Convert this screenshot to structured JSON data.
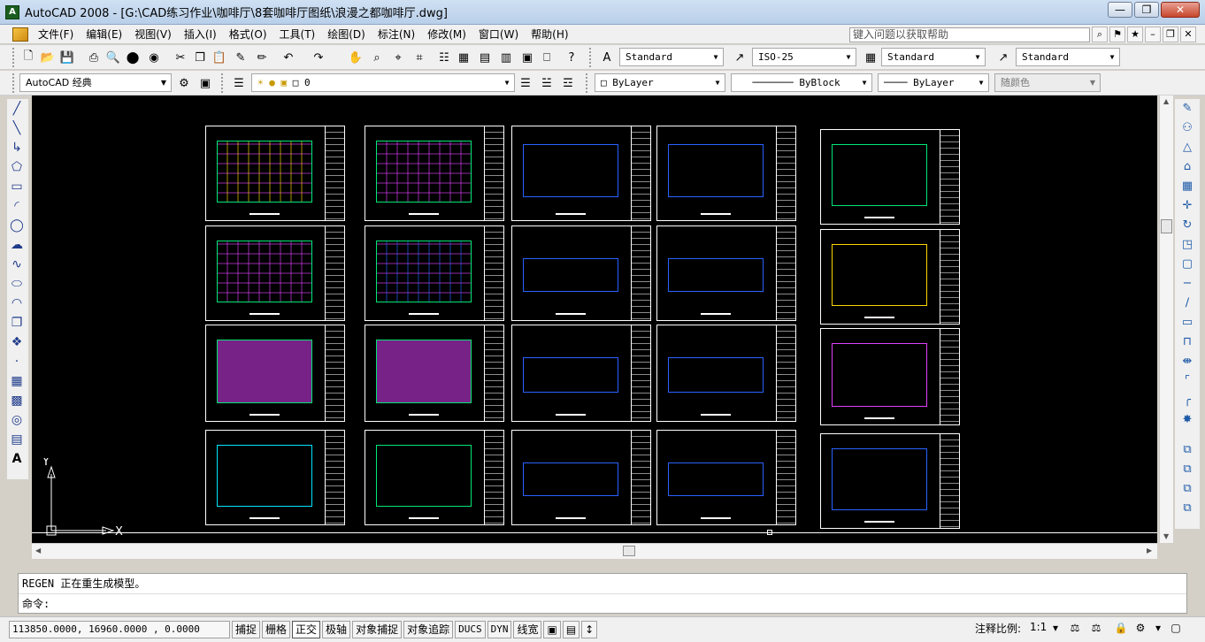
{
  "window": {
    "title": "AutoCAD 2008 - [G:\\CAD练习作业\\咖啡厅\\8套咖啡厅图纸\\浪漫之都咖啡厅.dwg]",
    "minimize": "—",
    "restore": "❐",
    "close": "✕"
  },
  "menu": {
    "items": [
      "文件(F)",
      "编辑(E)",
      "视图(V)",
      "插入(I)",
      "格式(O)",
      "工具(T)",
      "绘图(D)",
      "标注(N)",
      "修改(M)",
      "窗口(W)",
      "帮助(H)"
    ],
    "help_search_placeholder": "键入问题以获取帮助"
  },
  "toolbar1": {
    "text_style": "Standard",
    "dim_style": "ISO-25",
    "table_style": "Standard",
    "multileader_style": "Standard"
  },
  "toolbar2": {
    "workspace": "AutoCAD 经典",
    "layer": "0",
    "color": "ByLayer",
    "linetype": "ByBlock",
    "lineweight": "ByLayer",
    "plot_style": "随颜色"
  },
  "ucs": {
    "y": "Y",
    "x": "X"
  },
  "command": {
    "history": "REGEN 正在重生成模型。",
    "prompt": "命令:"
  },
  "status": {
    "coordinates": "113850.0000,  16960.0000 ,  0.0000",
    "buttons": [
      "捕捉",
      "栅格",
      "正交",
      "极轴",
      "对象捕捉",
      "对象追踪",
      "DUCS",
      "DYN",
      "线宽"
    ],
    "annotation_scale_label": "注释比例:",
    "annotation_scale_value": "1:1"
  },
  "colors": {
    "canvas": "#000000",
    "sheet_border": "#ffffff",
    "plan_green": "#00e676",
    "plan_magenta": "#e040fb",
    "plan_yellow": "#ffd600",
    "plan_blue": "#2962ff",
    "plan_cyan": "#00e5ff"
  }
}
